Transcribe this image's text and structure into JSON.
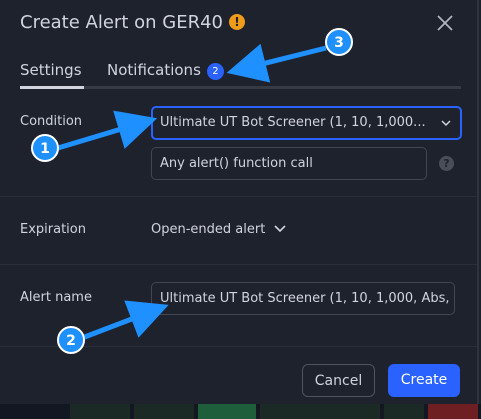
{
  "dialog": {
    "title": "Create Alert on GER40",
    "title_badge": "!",
    "close_icon": "close-icon"
  },
  "tabs": [
    {
      "label": "Settings",
      "active": true
    },
    {
      "label": "Notifications",
      "badge": "2",
      "active": false
    }
  ],
  "condition": {
    "label": "Condition",
    "value": "Ultimate UT Bot Screener (1, 10, 1,000...",
    "sub_value": "Any alert() function call",
    "help": "?"
  },
  "expiration": {
    "label": "Expiration",
    "value": "Open-ended alert"
  },
  "alert_name": {
    "label": "Alert name",
    "value": "Ultimate UT Bot Screener (1, 10, 1,000, Abs,"
  },
  "buttons": {
    "cancel": "Cancel",
    "create": "Create"
  },
  "markers": [
    "1",
    "2",
    "3"
  ],
  "colors": {
    "background": "#1e222d",
    "accent": "#2962ff",
    "warning": "#f09b1a",
    "annotation": "#1e90ff"
  }
}
